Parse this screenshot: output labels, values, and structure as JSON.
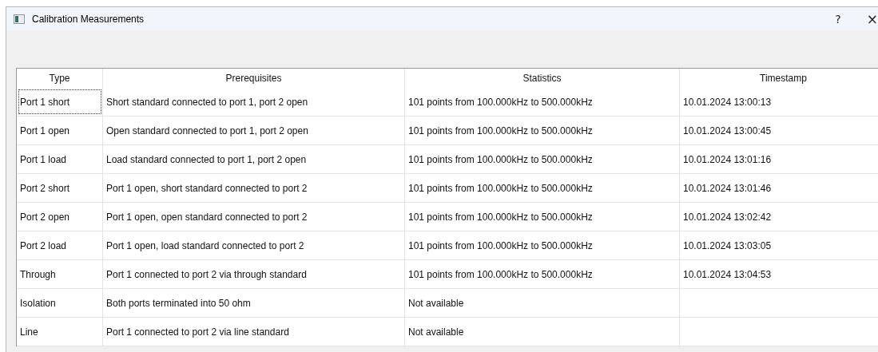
{
  "window": {
    "title": "Calibration Measurements",
    "buttons": [
      "?",
      "×"
    ]
  },
  "table": {
    "columns": [
      "Type",
      "Prerequisites",
      "Statistics",
      "Timestamp"
    ],
    "rows": [
      {
        "cells": [
          "Port 1 short",
          "Short standard connected to port 1, port 2 open",
          "101 points from 100.000kHz to 500.000kHz",
          "10.01.2024 13:00:13"
        ],
        "focused": true
      },
      {
        "cells": [
          "Port 1 open",
          "Open standard connected to port 1, port 2 open",
          "101 points from 100.000kHz to 500.000kHz",
          "10.01.2024 13:00:45"
        ],
        "focused": false
      },
      {
        "cells": [
          "Port 1 load",
          "Load standard connected to port 1, port 2 open",
          "101 points from 100.000kHz to 500.000kHz",
          "10.01.2024 13:01:16"
        ],
        "focused": false
      },
      {
        "cells": [
          "Port 2 short",
          "Port 1 open, short standard connected to port 2",
          "101 points from 100.000kHz to 500.000kHz",
          "10.01.2024 13:01:46"
        ],
        "focused": false
      },
      {
        "cells": [
          "Port 2 open",
          "Port 1 open, open standard connected to port 2",
          "101 points from 100.000kHz to 500.000kHz",
          "10.01.2024 13:02:42"
        ],
        "focused": false
      },
      {
        "cells": [
          "Port 2 load",
          "Port 1 open, load standard connected to port 2",
          "101 points from 100.000kHz to 500.000kHz",
          "10.01.2024 13:03:05"
        ],
        "focused": false
      },
      {
        "cells": [
          "Through",
          "Port 1 connected to port 2 via through standard",
          "101 points from 100.000kHz to 500.000kHz",
          "10.01.2024 13:04:53"
        ],
        "focused": false
      },
      {
        "cells": [
          "Isolation",
          "Both ports terminated into 50 ohm",
          "Not available"
        ],
        "focused": false
      },
      {
        "cells": [
          "Line",
          "Port 1 connected to port 2 via line standard",
          "Not available"
        ],
        "focused": false
      }
    ]
  }
}
